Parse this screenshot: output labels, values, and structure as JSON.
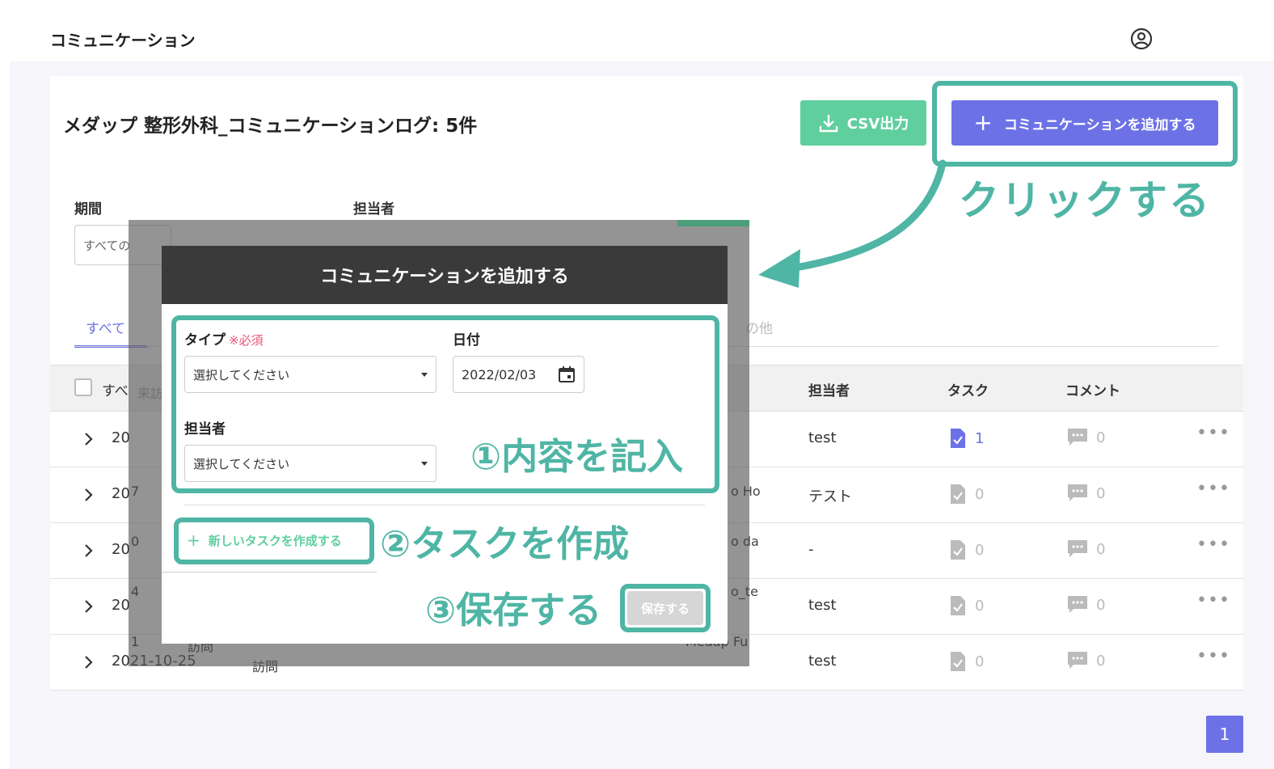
{
  "app": {
    "title": "コミュニケーション"
  },
  "card": {
    "title": "メダップ 整形外科_コミュニケーションログ: 5件",
    "csv_label": "CSV出力",
    "add_label": "コミュニケーションを追加する"
  },
  "filters": {
    "period_label": "期間",
    "period_value": "すべての",
    "assignee_label": "担当者"
  },
  "tabs": {
    "all": "すべて",
    "other_partial": "の他"
  },
  "table": {
    "select_all": "すべ",
    "under_overlay_text": "来訪",
    "col_assignee": "担当者",
    "col_task": "タスク",
    "col_comment": "コメント",
    "rows": [
      {
        "date": "20",
        "assignee": "test",
        "task_count": "1",
        "comment_count": "0"
      },
      {
        "date": "20",
        "assignee": "テスト",
        "task_count": "0",
        "comment_count": "0"
      },
      {
        "date": "20",
        "assignee": "-",
        "task_count": "0",
        "comment_count": "0"
      },
      {
        "date": "20",
        "assignee": "test",
        "task_count": "0",
        "comment_count": "0"
      },
      {
        "date": "2021-10-25",
        "type": "訪問",
        "assignee": "test",
        "task_count": "0",
        "comment_count": "0"
      }
    ],
    "overlay_fragments": [
      "7",
      "0",
      "4",
      "1",
      "訪問"
    ],
    "overlay_right_fragments": [
      "o Ho",
      "o da",
      "o_te",
      "Medap Fu"
    ]
  },
  "pagination": {
    "current": "1"
  },
  "modal": {
    "title": "コミュニケーションを追加する",
    "type_label": "タイプ",
    "required_note": "※必須",
    "type_placeholder": "選択してください",
    "date_label": "日付",
    "date_value": "2022/02/03",
    "assignee_label": "担当者",
    "assignee_placeholder": "選択してください",
    "new_task_label": "新しいタスクを作成する",
    "save_label": "保存する"
  },
  "annotations": {
    "click": "クリックする",
    "step1": "①内容を記入",
    "step2": "②タスクを作成",
    "step3": "③保存する"
  },
  "colors": {
    "accent": "#6c72e6",
    "csv_green": "#5fcf9e",
    "annotation_teal": "#4fb5a5",
    "required_red": "#e5547a"
  }
}
